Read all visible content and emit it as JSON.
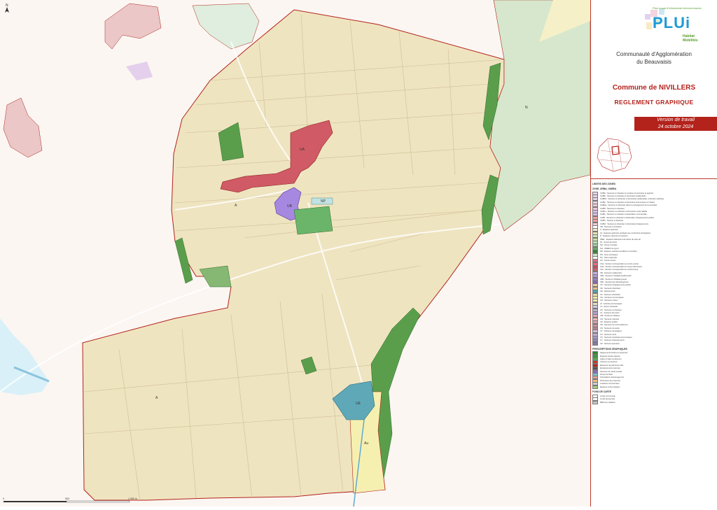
{
  "map": {
    "north_label": "N",
    "scale_labels": [
      "0",
      "500",
      "1 000 m"
    ],
    "zone_labels": {
      "n_east": "N",
      "a_southwest": "A",
      "a_center": "A",
      "ua": "UA",
      "ub": "UB",
      "ue": "UE",
      "au": "Au",
      "np": "NP"
    }
  },
  "panel": {
    "logo": {
      "tagline": "Plan Local d'Urbanisme intercommunal",
      "title": "PLUi",
      "sub1": "Habitat",
      "sub2": "Mobilités"
    },
    "org_line1": "Communauté d'Agglomération",
    "org_line2": "du Beauvaisis",
    "commune": "Commune de NIVILLERS",
    "reglement": "REGLEMENT GRAPHIQUE",
    "version_line1": "Version de travail",
    "version_line2": "24 octobre 2024"
  },
  "legend": {
    "heading1": "LIMITES DES ZONES",
    "heading2": "ZONE, URBA, OUBEA",
    "zones": [
      {
        "label": "UA/Ba : Secteurs à urbaniser à vocation économique et agricole",
        "color": "#e8d4e8"
      },
      {
        "label": "UA/Bb : Secteurs à urbaniser à dominante résidentielle",
        "color": "#e8d4e8"
      },
      {
        "label": "UA/Bbh : Secteurs à urbaniser à dominante résidentielle, à densité maîtrisée",
        "color": "#e8d4e8"
      },
      {
        "label": "UA/Bp : Secteurs à urbaniser à dominante économique et urbaine",
        "color": "#e8d4e8"
      },
      {
        "label": "UA/Bpa : Secteurs à urbaniser dans le prolongement de la centralité",
        "color": "#f2c8d8"
      },
      {
        "label": "UA/Bd : Secteurs à urbaniser",
        "color": "#f2c8d8"
      },
      {
        "label": "UA/Bm : Secteurs à urbaniser à dominante mixte habitat",
        "color": "#d8c0e8"
      },
      {
        "label": "UA/Bs : Secteurs à urbaniser à destination commerciale",
        "color": "#d8c0e8"
      },
      {
        "label": "UA/Bt : Secteurs à urbaniser à destination d'équipements publics",
        "color": "#f0a0a0"
      },
      {
        "label": "UA/Bv : Secteur à urbaniser",
        "color": "#f0a0a0"
      },
      {
        "label": "UA/Bw : Secteurs à urbaniser à dominante d'équipements",
        "color": "#f2c8d8"
      },
      {
        "label": "UB : Secteurs à urbaniser",
        "color": "#ffffff"
      },
      {
        "label": "A : Espaces agricoles",
        "color": "#f3ebc7"
      },
      {
        "label": "Ap : Espaces agricoles protégés aux continuités écologiques",
        "color": "#e8e0b8"
      },
      {
        "label": "N : Espaces naturels et forestiers",
        "color": "#cfe3c4"
      },
      {
        "label": "NBaL : Espaces Naturels et de loisirs de plein air",
        "color": "#c8e0a0"
      },
      {
        "label": "NL : Zones de loisirs",
        "color": "#b8e0b8"
      },
      {
        "label": "NH : Zones humides",
        "color": "#98d098"
      },
      {
        "label": "NG : ZNIEFF de type 1",
        "color": "#6aa86a"
      },
      {
        "label": "NP : Espaces naturels sensibles et corridors",
        "color": "#2a8a2a"
      },
      {
        "label": "NS : Zone touristique",
        "color": "#d0e8d0"
      },
      {
        "label": "NV : Parcs agricoles",
        "color": "#ffffff"
      },
      {
        "label": "UA : Centre ancien",
        "color": "#e07080"
      },
      {
        "label": "UAa : Secteur correspondant au centre ancien",
        "color": "#e07080"
      },
      {
        "label": "UAb : Secteur correspondant au noyau bâti ancien",
        "color": "#c05060"
      },
      {
        "label": "UAc : Secteur correspondant au centre-bourg",
        "color": "#d06070"
      },
      {
        "label": "UB : Secteurs résidentiels",
        "color": "#c8b0e8"
      },
      {
        "label": "UBa : Secteurs d'habitat pavillonnaire",
        "color": "#b098d8"
      },
      {
        "label": "UBb : Secteurs d'habitat groupé",
        "color": "#9880c8"
      },
      {
        "label": "UBc : Secteurs de développement",
        "color": "#8868b8"
      },
      {
        "label": "UC : Secteurs d'équipements publics",
        "color": "#f0d0a0"
      },
      {
        "label": "UD : Secteurs d'activités",
        "color": "#e0c090"
      },
      {
        "label": "UE : Équipements",
        "color": "#4aa8b8"
      },
      {
        "label": "UF : Secteurs d'activités",
        "color": "#e8e0a0"
      },
      {
        "label": "UG : Secteurs économiques",
        "color": "#f0e8a8"
      },
      {
        "label": "UH : Secteurs mixtes",
        "color": "#f0e8b0"
      },
      {
        "label": "UI : Activités économiques",
        "color": "#e8e0c0"
      },
      {
        "label": "UJ : Zones d'activités",
        "color": "#d8c8e8"
      },
      {
        "label": "UK : Secteurs à urbaniser",
        "color": "#c0b0d8"
      },
      {
        "label": "UL : Secteurs de loisirs",
        "color": "#b0a0d0"
      },
      {
        "label": "UM : Secteurs militaires",
        "color": "#e0a8b8"
      },
      {
        "label": "UN : Secteurs naturels",
        "color": "#f0b8c0"
      },
      {
        "label": "UP : Espaces publics",
        "color": "#d8a0b0"
      },
      {
        "label": "UR : Secteurs de renouvellement",
        "color": "#c89098"
      },
      {
        "label": "US : Secteurs de santé",
        "color": "#b88088"
      },
      {
        "label": "UT : Secteurs touristiques",
        "color": "#d0c0e0"
      },
      {
        "label": "UV : Secteurs verts",
        "color": "#c0b0d8"
      },
      {
        "label": "UX : Secteurs d'activités économiques",
        "color": "#a898c8"
      },
      {
        "label": "UY : Secteurs d'équipements",
        "color": "#9888b8"
      },
      {
        "label": "UZ : Secteurs spéciaux",
        "color": "#8878a8"
      }
    ],
    "heading3": "PRESCRIPTIONS GRAPHIQUES",
    "prescriptions": [
      {
        "label": "Alignements d'arbres à préserver",
        "color": "#2a8a2a"
      },
      {
        "label": "Espaces boisés classés",
        "color": "#3a9a3a"
      },
      {
        "label": "Haies et talus à préserver",
        "color": "#5aaa5a"
      },
      {
        "label": "Chemins à préserver",
        "color": "#c0392b"
      },
      {
        "label": "Éléments de patrimoine bâti",
        "color": "#b3221b"
      },
      {
        "label": "Emplacements réservés",
        "color": "#555555"
      },
      {
        "label": "Secteurs de mixité sociale",
        "color": "#8a6abf"
      },
      {
        "label": "Zones humides",
        "color": "#7ac0d0"
      },
      {
        "label": "Orientations d'aménagement",
        "color": "#e0a0a0"
      },
      {
        "label": "Périmètres de protection",
        "color": "#f0c080"
      },
      {
        "label": "Linéaires commerciaux",
        "color": "#d0d0d0"
      },
      {
        "label": "Espaces verts protégés",
        "color": "#a0d080"
      }
    ],
    "heading4": "FOND DE CARTE",
    "fond": [
      {
        "label": "Limite communale",
        "color": "#ffffff"
      },
      {
        "label": "Limite de parcelle",
        "color": "#ffffff"
      },
      {
        "label": "Bâtiment cadastré",
        "color": "#c8c8c8"
      }
    ]
  },
  "colors": {
    "agri": "#efe4c0",
    "border": "#b3221b",
    "ua": "#d85c6a",
    "ub": "#a688e0",
    "np": "#4f9a4a",
    "n": "#cfe3c4",
    "ue": "#6ab0c0",
    "au": "#f6f0b0"
  }
}
